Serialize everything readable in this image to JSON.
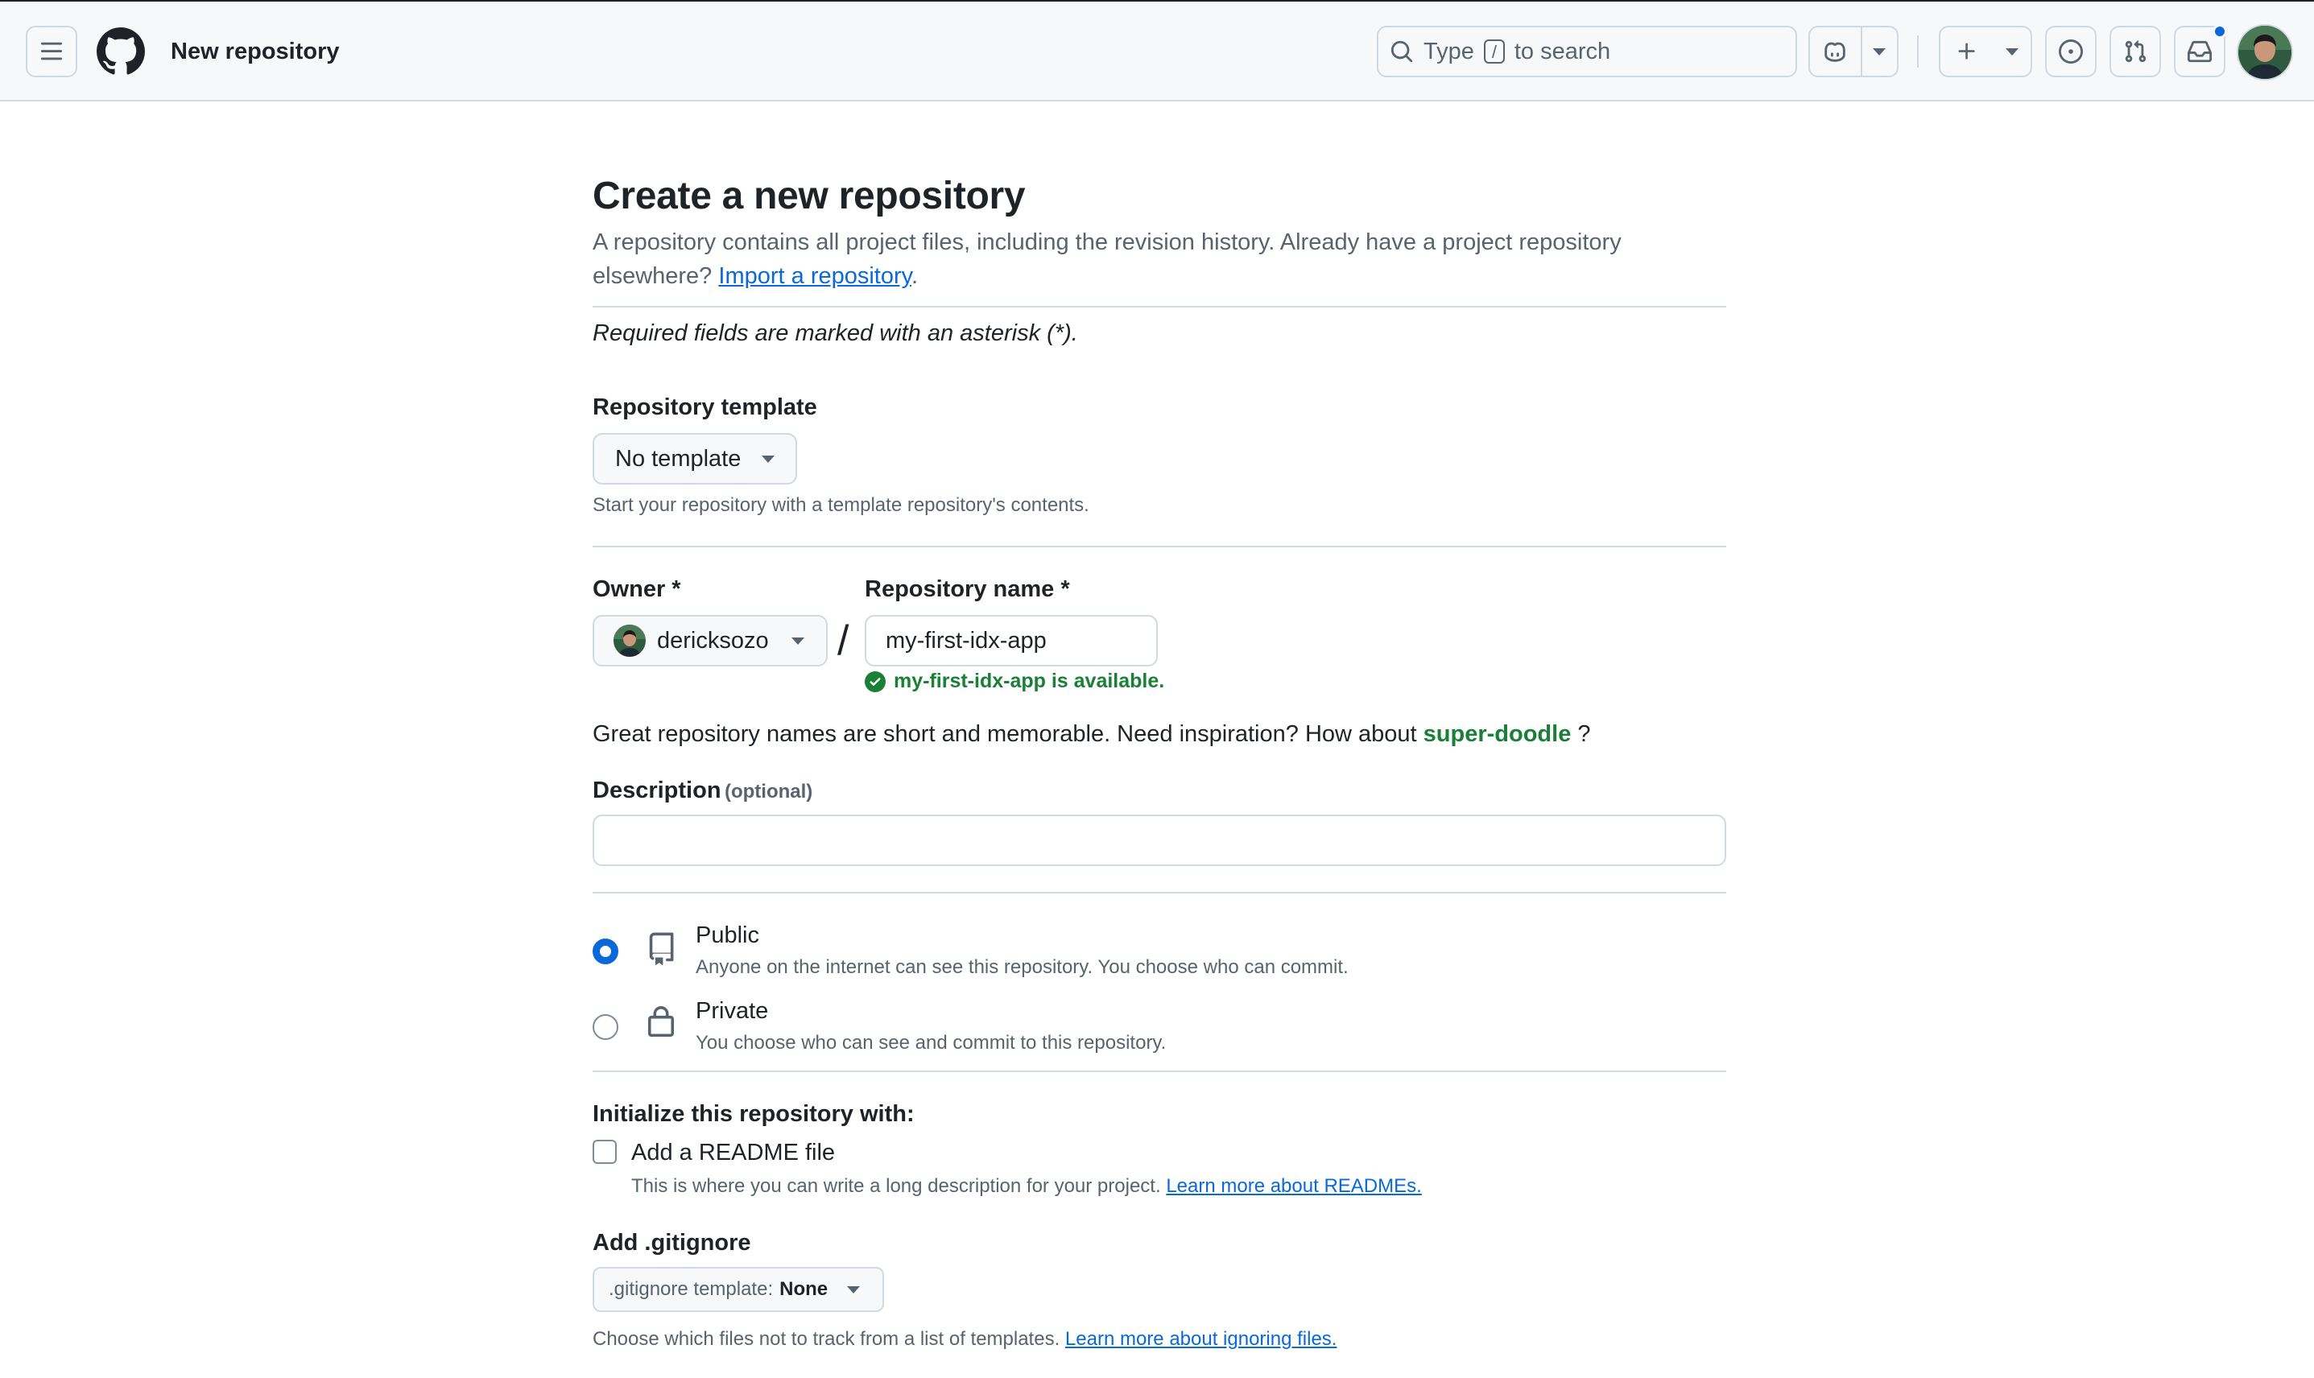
{
  "header": {
    "page_title": "New repository",
    "search": {
      "prefix": "Type",
      "key": "/",
      "suffix": "to search"
    },
    "has_notification": true
  },
  "main": {
    "title": "Create a new repository",
    "intro_text": "A repository contains all project files, including the revision history. Already have a project repository elsewhere?",
    "import_link": "Import a repository",
    "intro_end": ".",
    "required_note": "Required fields are marked with an asterisk (*).",
    "template": {
      "label": "Repository template",
      "selected": "No template",
      "hint": "Start your repository with a template repository's contents."
    },
    "owner": {
      "label": "Owner *",
      "value": "dericksozo"
    },
    "separator": "/",
    "repo_name": {
      "label": "Repository name *",
      "value": "my-first-idx-app",
      "availability": "my-first-idx-app is available."
    },
    "inspiration": {
      "text": "Great repository names are short and memorable. Need inspiration? How about",
      "suggestion": "super-doodle",
      "end": "?"
    },
    "description": {
      "label": "Description",
      "optional": "(optional)",
      "value": ""
    },
    "visibility": [
      {
        "title": "Public",
        "desc": "Anyone on the internet can see this repository. You choose who can commit.",
        "selected": true,
        "icon": "repo-icon"
      },
      {
        "title": "Private",
        "desc": "You choose who can see and commit to this repository.",
        "selected": false,
        "icon": "lock-icon"
      }
    ],
    "initialize": {
      "heading": "Initialize this repository with:",
      "readme_label": "Add a README file",
      "readme_checked": false,
      "readme_hint": "This is where you can write a long description for your project.",
      "readme_link": "Learn more about READMEs."
    },
    "gitignore": {
      "heading": "Add .gitignore",
      "button_prefix": ".gitignore template:",
      "button_value": "None",
      "hint": "Choose which files not to track from a list of templates.",
      "hint_link": "Learn more about ignoring files."
    }
  },
  "colors": {
    "accent": "#0969da",
    "success": "#1a7f37",
    "border": "#d1d9e0",
    "muted": "#59636e"
  }
}
